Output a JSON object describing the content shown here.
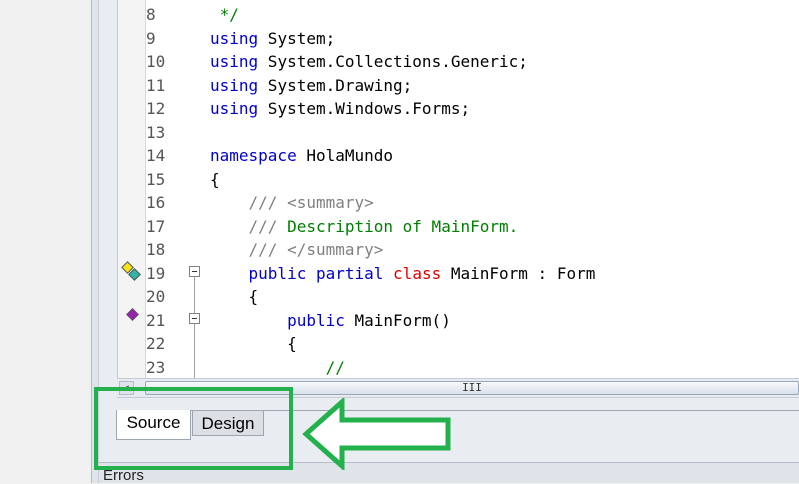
{
  "editor": {
    "lines": [
      {
        "num": "8",
        "tokens": [
          {
            "t": " */",
            "c": "cm"
          }
        ]
      },
      {
        "num": "9",
        "tokens": [
          {
            "t": "using",
            "c": "kw"
          },
          {
            "t": " System;",
            "c": ""
          }
        ]
      },
      {
        "num": "10",
        "tokens": [
          {
            "t": "using",
            "c": "kw"
          },
          {
            "t": " System.Collections.Generic;",
            "c": ""
          }
        ]
      },
      {
        "num": "11",
        "tokens": [
          {
            "t": "using",
            "c": "kw"
          },
          {
            "t": " System.Drawing;",
            "c": ""
          }
        ]
      },
      {
        "num": "12",
        "tokens": [
          {
            "t": "using",
            "c": "kw"
          },
          {
            "t": " System.Windows.Forms;",
            "c": ""
          }
        ]
      },
      {
        "num": "13",
        "tokens": []
      },
      {
        "num": "14",
        "tokens": [
          {
            "t": "namespace",
            "c": "kw"
          },
          {
            "t": " HolaMundo",
            "c": ""
          }
        ]
      },
      {
        "num": "15",
        "tokens": [
          {
            "t": "{",
            "c": ""
          }
        ]
      },
      {
        "num": "16",
        "tokens": [
          {
            "t": "    /// ",
            "c": "doc"
          },
          {
            "t": "<summary>",
            "c": "doc"
          }
        ]
      },
      {
        "num": "17",
        "tokens": [
          {
            "t": "    /// ",
            "c": "doc"
          },
          {
            "t": "Description of MainForm.",
            "c": "cm"
          }
        ]
      },
      {
        "num": "18",
        "tokens": [
          {
            "t": "    /// ",
            "c": "doc"
          },
          {
            "t": "</summary>",
            "c": "doc"
          }
        ]
      },
      {
        "num": "19",
        "tokens": [
          {
            "t": "    public",
            "c": "kw"
          },
          {
            "t": " ",
            "c": ""
          },
          {
            "t": "partial",
            "c": "kw"
          },
          {
            "t": " ",
            "c": ""
          },
          {
            "t": "class",
            "c": "kw2"
          },
          {
            "t": " MainForm : Form",
            "c": ""
          }
        ]
      },
      {
        "num": "20",
        "tokens": [
          {
            "t": "    {",
            "c": ""
          }
        ]
      },
      {
        "num": "21",
        "tokens": [
          {
            "t": "        public",
            "c": "kw"
          },
          {
            "t": " MainForm()",
            "c": ""
          }
        ]
      },
      {
        "num": "22",
        "tokens": [
          {
            "t": "        {",
            "c": ""
          }
        ]
      },
      {
        "num": "23",
        "tokens": [
          {
            "t": "            //",
            "c": "cm"
          }
        ]
      }
    ],
    "scroll_grip": "III"
  },
  "tabs": {
    "source_label": "Source",
    "design_label": "Design"
  },
  "bottom": {
    "errors_label": "Errors"
  },
  "annotation": {
    "highlight_color": "#22b14c"
  }
}
